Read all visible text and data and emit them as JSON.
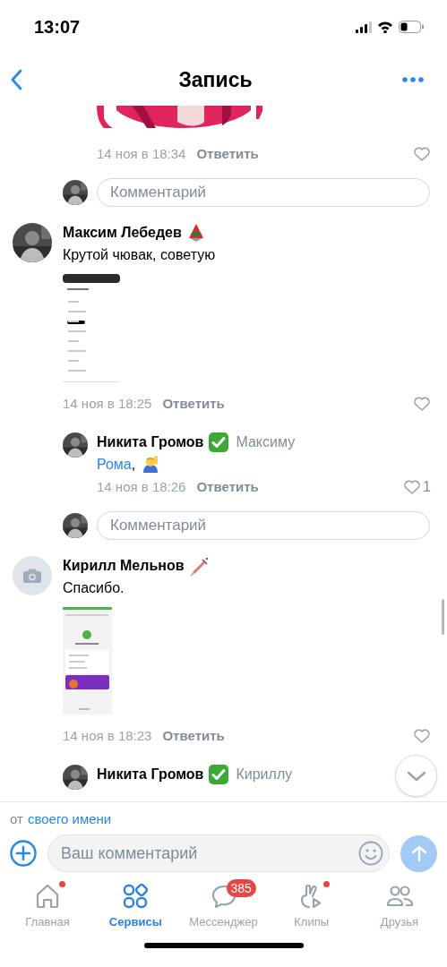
{
  "status_bar": {
    "time": "13:07"
  },
  "header": {
    "title": "Запись"
  },
  "thread": [
    {
      "kind": "continued",
      "children": [
        {
          "kind": "sticker_tail",
          "date": "14 ноя в 18:34",
          "reply_label": "Ответить"
        },
        {
          "kind": "comment_field",
          "placeholder": "Комментарий"
        }
      ]
    },
    {
      "kind": "comment",
      "author": "Максим Лебедев",
      "text": "Крутой чювак, советую",
      "date": "14 ноя в 18:25",
      "reply_label": "Ответить",
      "children": [
        {
          "kind": "comment",
          "author": "Никита Громов",
          "addressee": "Максиму",
          "mention": "Рома",
          "text": ",",
          "date": "14 ноя в 18:26",
          "reply_label": "Ответить",
          "likes": "1"
        },
        {
          "kind": "comment_field",
          "placeholder": "Комментарий"
        }
      ]
    },
    {
      "kind": "comment",
      "author": "Кирилл Мельнов",
      "text": "Спасибо.",
      "date": "14 ноя в 18:23",
      "reply_label": "Ответить",
      "children": [
        {
          "kind": "comment",
          "author": "Никита Громов",
          "addressee": "Кириллу"
        }
      ]
    }
  ],
  "composer": {
    "from_prefix": "от",
    "from_link": "своего имени",
    "placeholder": "Ваш комментарий"
  },
  "tabs": [
    {
      "label": "Главная",
      "selected": false,
      "dot": true
    },
    {
      "label": "Сервисы",
      "selected": true,
      "dot": false
    },
    {
      "label": "Мессенджер",
      "selected": false,
      "dot": false,
      "badge": "385"
    },
    {
      "label": "Клипы",
      "selected": false,
      "dot": true
    },
    {
      "label": "Друзья",
      "selected": false,
      "dot": false
    }
  ]
}
